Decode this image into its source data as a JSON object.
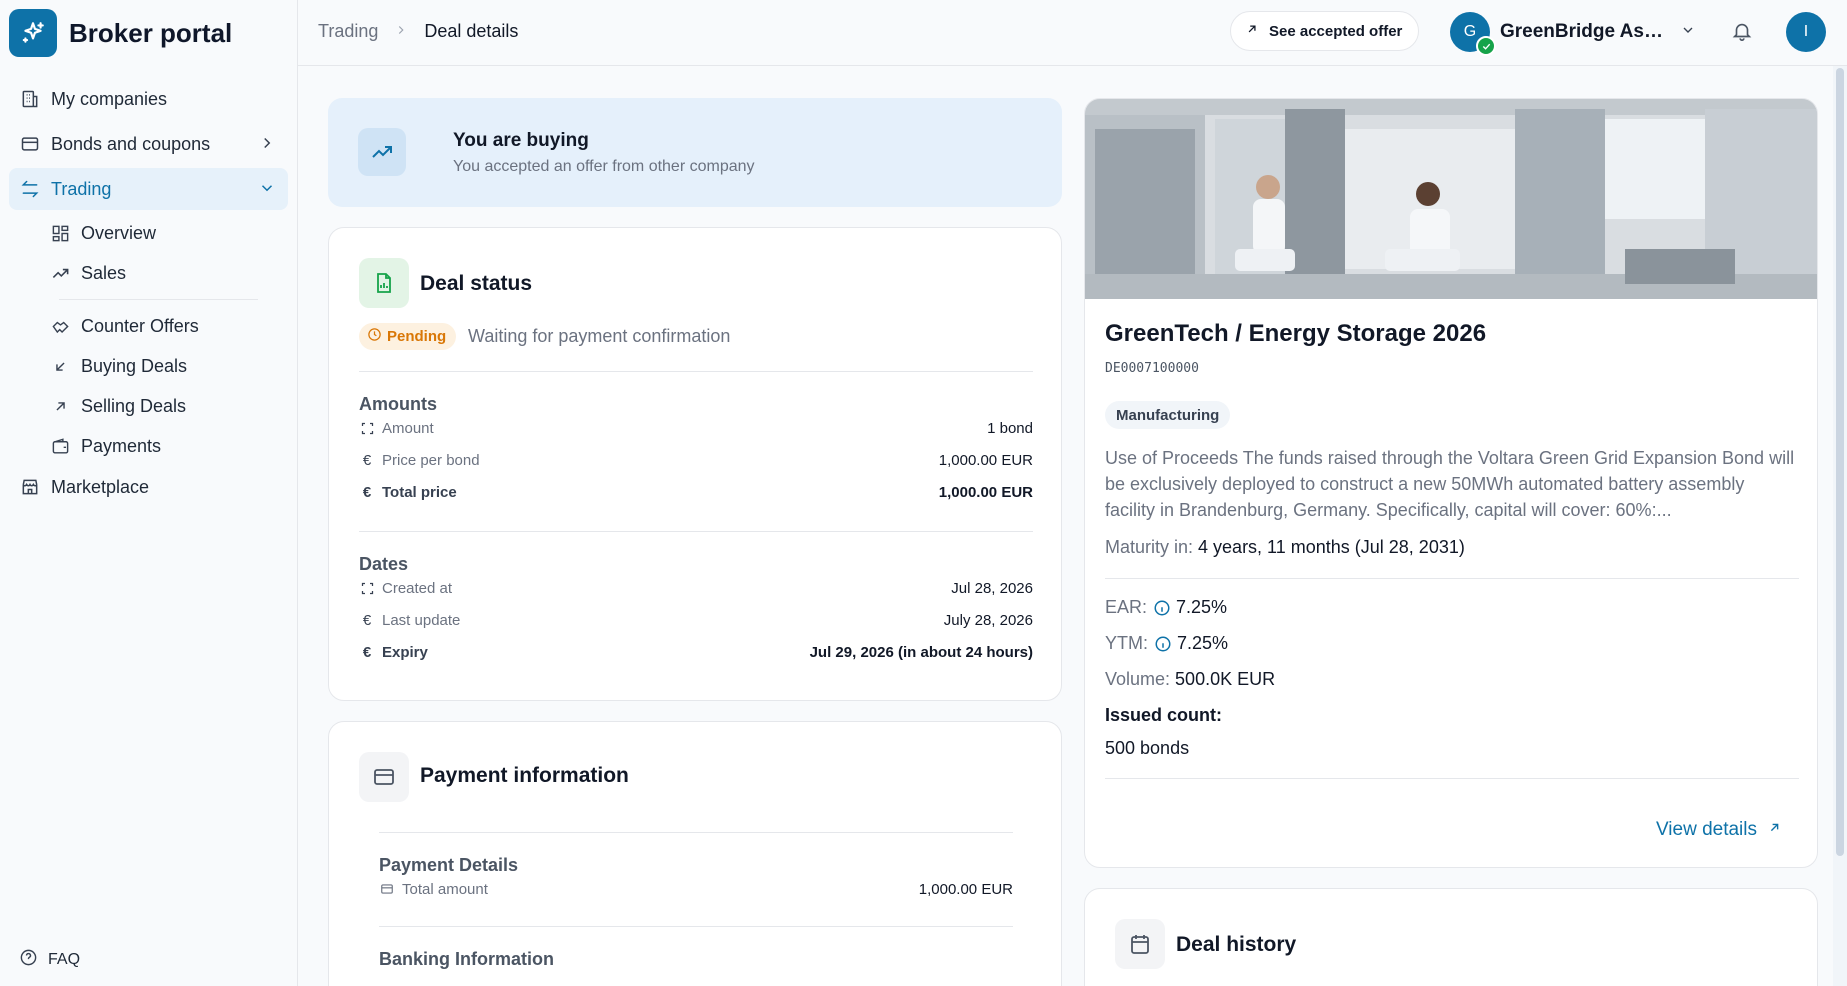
{
  "brand": {
    "title": "Broker portal"
  },
  "sidebar": {
    "items": [
      {
        "label": "My companies",
        "icon": "building-icon"
      },
      {
        "label": "Bonds and coupons",
        "icon": "card-icon"
      },
      {
        "label": "Trading",
        "icon": "arrows-exchange-icon"
      },
      {
        "label": "Marketplace",
        "icon": "store-icon"
      }
    ],
    "trading_sub": [
      {
        "label": "Overview",
        "icon": "dashboard-icon"
      },
      {
        "label": "Sales",
        "icon": "trend-up-icon"
      },
      {
        "label": "Counter Offers",
        "icon": "handshake-icon"
      },
      {
        "label": "Buying Deals",
        "icon": "arrow-down-left-icon"
      },
      {
        "label": "Selling Deals",
        "icon": "arrow-up-right-icon"
      },
      {
        "label": "Payments",
        "icon": "wallet-icon"
      }
    ],
    "faq": "FAQ"
  },
  "header": {
    "breadcrumb": {
      "parent": "Trading",
      "current": "Deal details"
    },
    "accepted_offer_label": "See accepted offer",
    "company": {
      "initial": "G",
      "name": "GreenBridge Asset Management"
    },
    "user_initial": "I"
  },
  "buying_banner": {
    "title": "You are buying",
    "subtitle": "You accepted an offer from other company"
  },
  "deal_status": {
    "title": "Deal status",
    "badge": "Pending",
    "message": "Waiting for payment confirmation",
    "amounts": {
      "title": "Amounts",
      "rows": [
        {
          "label": "Amount",
          "value": "1 bond"
        },
        {
          "label": "Price per bond",
          "value": "1,000.00 EUR"
        },
        {
          "label": "Total price",
          "value": "1,000.00 EUR"
        }
      ]
    },
    "dates": {
      "title": "Dates",
      "rows": [
        {
          "label": "Created at",
          "value": "Jul 28, 2026"
        },
        {
          "label": "Last update",
          "value": "July 28, 2026"
        },
        {
          "label": "Expiry",
          "value": "Jul 29, 2026 (in about 24 hours)"
        }
      ]
    }
  },
  "payment": {
    "title": "Payment information",
    "details_title": "Payment Details",
    "total_label": "Total amount",
    "total_value": "1,000.00 EUR",
    "banking_title": "Banking Information"
  },
  "bond": {
    "title": "GreenTech / Energy Storage 2026",
    "isin": "DE0007100000",
    "sector": "Manufacturing",
    "description": "Use of Proceeds The funds raised through the Voltara Green Grid Expansion Bond will be exclusively deployed to construct a new 50MWh automated battery assembly facility in Brandenburg, Germany. Specifically, capital will cover: 60%:...",
    "maturity_label": "Maturity in:",
    "maturity_value": "4 years, 11 months (Jul 28, 2031)",
    "ear_label": "EAR:",
    "ear_value": "7.25%",
    "ytm_label": "YTM:",
    "ytm_value": "7.25%",
    "volume_label": "Volume:",
    "volume_value": "500.0K EUR",
    "issued_label": "Issued count:",
    "issued_value": "500 bonds",
    "view_details": "View details"
  },
  "history": {
    "title": "Deal history"
  },
  "colors": {
    "accent": "#0e72a8",
    "pending": "#d97706",
    "success": "#16a34a"
  }
}
